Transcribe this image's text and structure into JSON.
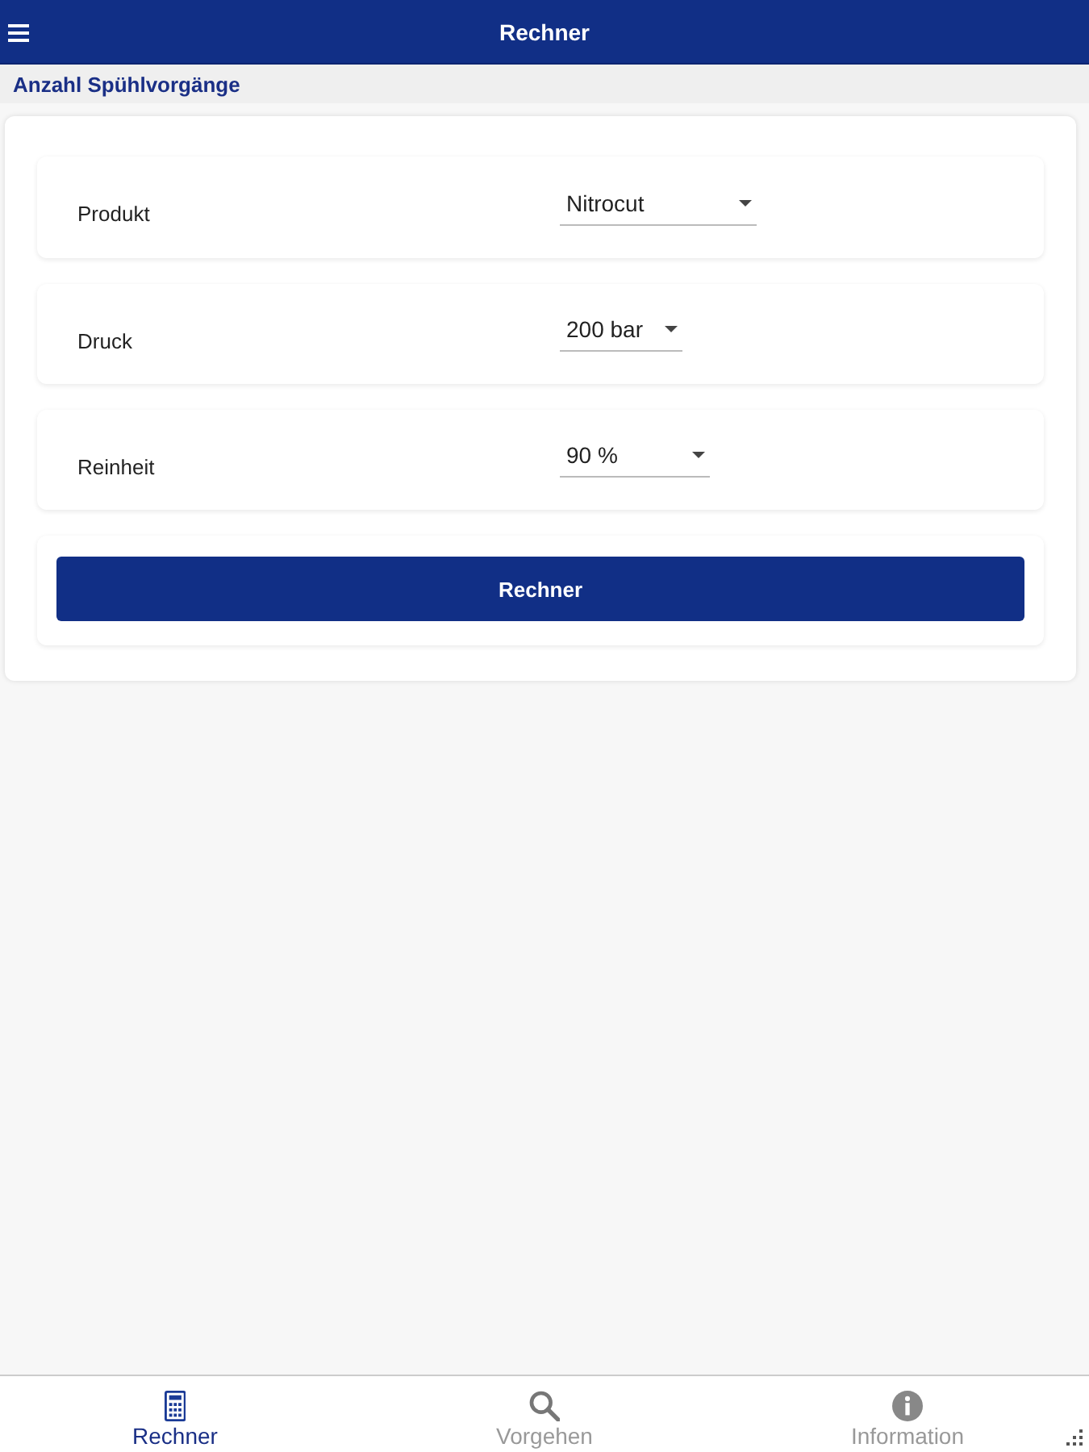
{
  "header": {
    "title": "Rechner"
  },
  "section_title": "Anzahl Spühlvorgänge",
  "fields": [
    {
      "label": "Produkt",
      "value": "Nitrocut"
    },
    {
      "label": "Druck",
      "value": "200 bar"
    },
    {
      "label": "Reinheit",
      "value": "90 %"
    }
  ],
  "button": "Rechner",
  "bottom_nav": [
    {
      "label": "Rechner",
      "kind": "calculator",
      "selected": true
    },
    {
      "label": "Vorgehen",
      "kind": "search",
      "selected": false
    },
    {
      "label": "Information",
      "kind": "info",
      "selected": false
    }
  ]
}
